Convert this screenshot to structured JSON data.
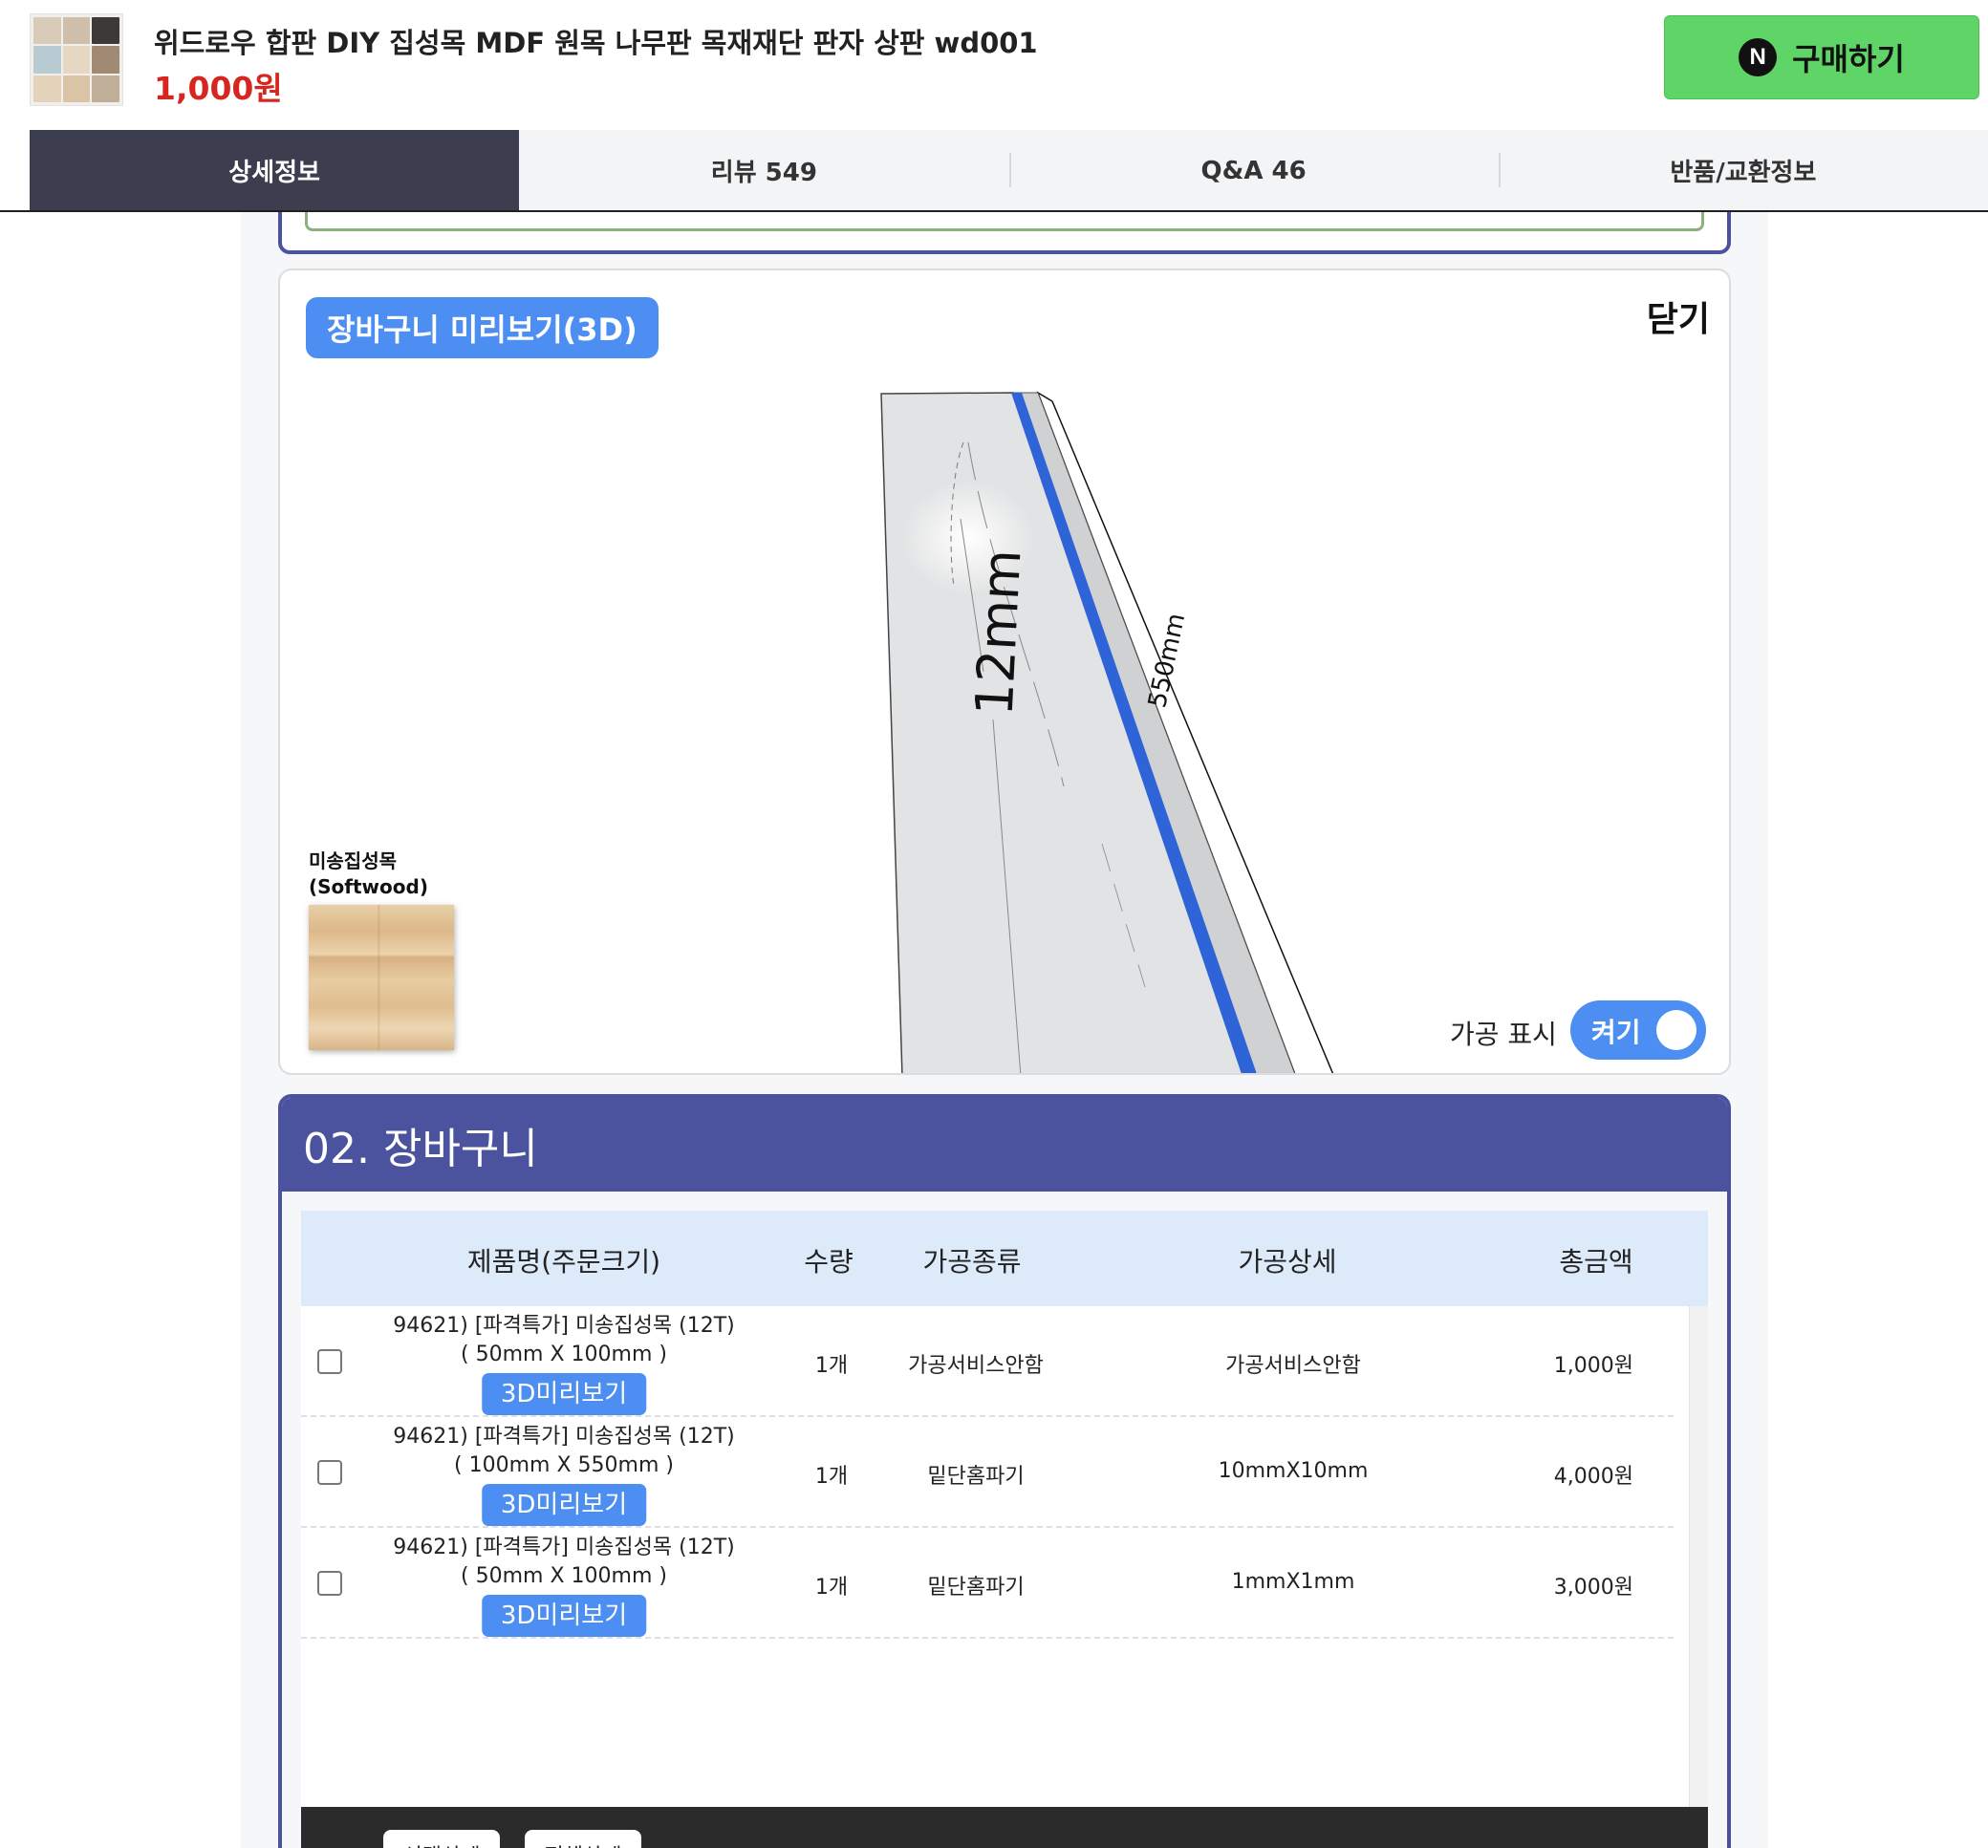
{
  "product": {
    "title": "위드로우 합판 DIY 집성목 MDF 원목 나무판 목재재단 판자 상판 wd001",
    "price": "1,000원",
    "buy_icon": "N",
    "buy_label": "구매하기"
  },
  "tabs": [
    {
      "label": "상세정보"
    },
    {
      "label": "리뷰 549"
    },
    {
      "label": "Q&A 46"
    },
    {
      "label": "반품/교환정보"
    }
  ],
  "preview": {
    "tag": "장바구니 미리보기(3D)",
    "close_label": "닫기",
    "thickness_label": "12mm",
    "length_label": "550mm",
    "material_name": "미송집성목",
    "material_en": "(Softwood)",
    "toggle_label": "가공 표시",
    "toggle_state": "켜기"
  },
  "cart": {
    "title": "02. 장바구니",
    "columns": [
      "제품명(주문크기)",
      "수량",
      "가공종류",
      "가공상세",
      "총금액"
    ],
    "rows": [
      {
        "name": "94621) [파격특가] 미송집성목 (12T)",
        "size": "( 50mm X 100mm )",
        "preview_label": "3D미리보기",
        "qty": "1개",
        "process": "가공서비스안함",
        "detail": "가공서비스안함",
        "total": "1,000원"
      },
      {
        "name": "94621) [파격특가] 미송집성목 (12T)",
        "size": "( 100mm X 550mm )",
        "preview_label": "3D미리보기",
        "qty": "1개",
        "process": "밑단홈파기",
        "detail": "10mmX10mm",
        "total": "4,000원"
      },
      {
        "name": "94621) [파격특가] 미송집성목 (12T)",
        "size": "( 50mm X 100mm )",
        "preview_label": "3D미리보기",
        "qty": "1개",
        "process": "밑단홈파기",
        "detail": "1mmX1mm",
        "total": "3,000원"
      }
    ],
    "footer_buttons": [
      "선택삭제",
      "전체삭제"
    ]
  },
  "colors": {
    "buy_green": "#5fd567",
    "price_red": "#d7261f",
    "accent_blue": "#4c8ef1",
    "cart_header": "#4b539f",
    "active_tab": "#3c3d4f"
  }
}
